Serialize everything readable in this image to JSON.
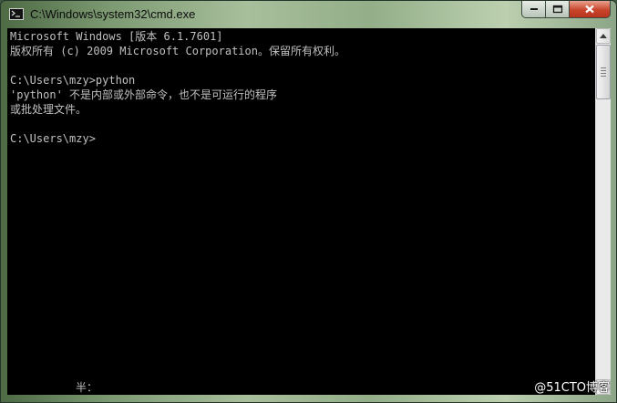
{
  "window": {
    "title": "C:\\Windows\\system32\\cmd.exe",
    "icon": "cmd-icon"
  },
  "controls": {
    "minimize_icon": "minimize-icon",
    "maximize_icon": "maximize-icon",
    "close_icon": "close-icon"
  },
  "console": {
    "lines": [
      "Microsoft Windows [版本 6.1.7601]",
      "版权所有 (c) 2009 Microsoft Corporation。保留所有权利。",
      "",
      "C:\\Users\\mzy>python",
      "'python' 不是内部或外部命令，也不是可运行的程序",
      "或批处理文件。",
      "",
      "C:\\Users\\mzy>"
    ],
    "ime_status": "半："
  },
  "watermark": "@51CTO博客",
  "colors": {
    "console_bg": "#000000",
    "console_fg": "#c0c0c0",
    "close_button": "#c8452c"
  }
}
